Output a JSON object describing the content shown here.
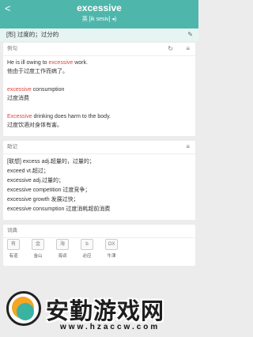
{
  "header": {
    "back_label": "<",
    "word": "excessive",
    "phonetic": "英 [ik sesiv] ◂)"
  },
  "meaning": {
    "text": "[形] 过度的；过分的",
    "edit_icon": "edit-icon"
  },
  "examples": {
    "title": "例句",
    "items": [
      {
        "pre": "He is ill owing to ",
        "hl": "excessive",
        "post": " work.",
        "zh": "他由于过度工作而病了。"
      },
      {
        "pre": "",
        "hl": "excessive",
        "post": " consumption",
        "zh": "过度消费"
      },
      {
        "pre": "",
        "hl": "Excessive",
        "post": " drinking does harm to the body.",
        "zh": "过度饮酒对身体有害。"
      }
    ]
  },
  "memory": {
    "title": "助记",
    "lines": [
      "[联想] excess adj.超量的，过量的；",
      "exceed vt.超过；",
      "excessive adj.过量的；",
      "excessive competition 过度竞争；",
      "excessive growth 发展过快；",
      "excessive consumption 过度消耗超前消费"
    ]
  },
  "dictionaries": {
    "title": "词典",
    "items": [
      {
        "label": "有道",
        "icon": "youdao-icon",
        "glyph": "有"
      },
      {
        "label": "金山",
        "icon": "jinshan-icon",
        "glyph": "金"
      },
      {
        "label": "海词",
        "icon": "haici-icon",
        "glyph": "海"
      },
      {
        "label": "必应",
        "icon": "bing-icon",
        "glyph": "b"
      },
      {
        "label": "牛津",
        "icon": "oxford-icon",
        "glyph": "OX"
      }
    ]
  },
  "watermark": {
    "title": "安勤游戏网",
    "url": "www.hzaccw.com"
  },
  "colors": {
    "header": "#4fb6ab",
    "highlight": "#e0443a",
    "meaning_bg": "#e6f4f2"
  }
}
